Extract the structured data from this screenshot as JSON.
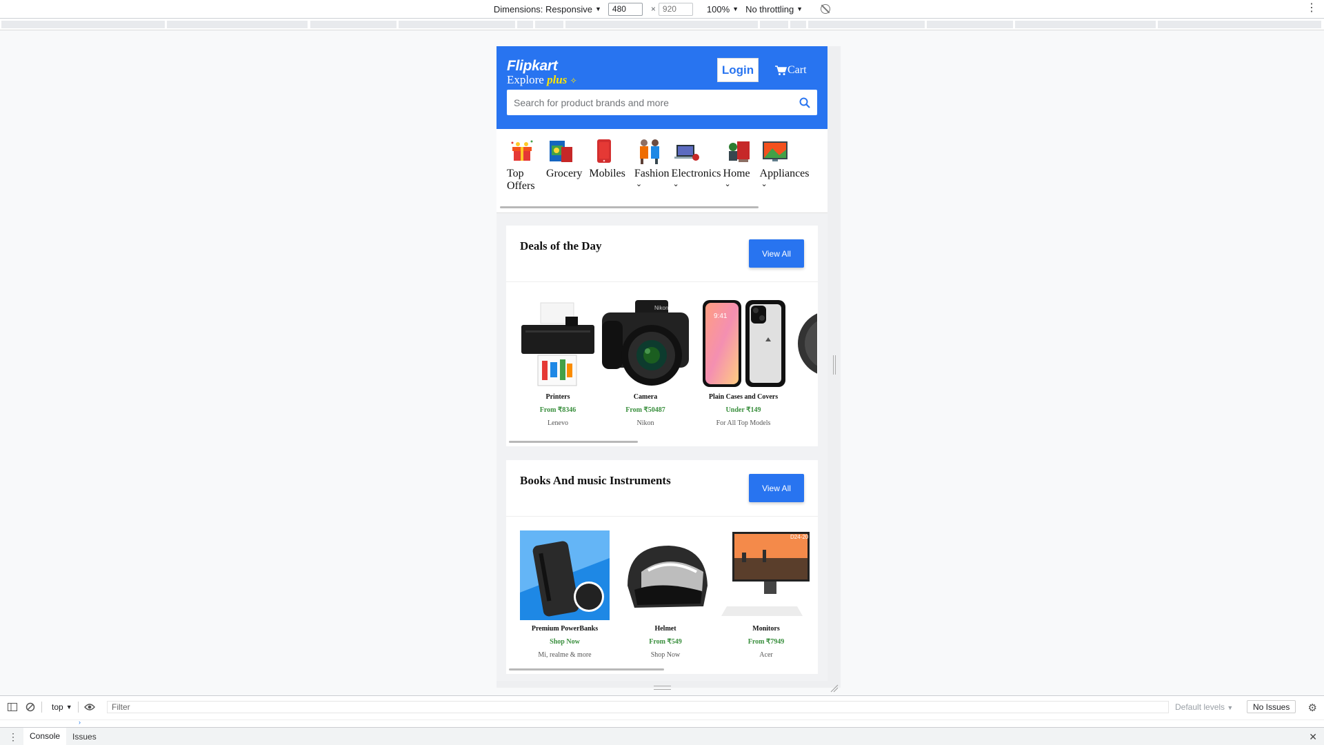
{
  "devtools": {
    "dimensions_label": "Dimensions: Responsive",
    "width": "480",
    "height": "920",
    "zoom": "100%",
    "throttling": "No throttling"
  },
  "header": {
    "logo": "Flipkart",
    "explore": "Explore",
    "plus": "plus",
    "login": "Login",
    "cart": "Cart",
    "search_placeholder": "Search for product brands and more"
  },
  "categories": [
    {
      "line1": "Top",
      "line2": "Offers",
      "chevron": false,
      "icon": "gift-icon"
    },
    {
      "line1": "Grocery",
      "line2": "",
      "chevron": false,
      "icon": "grocery-icon"
    },
    {
      "line1": "Mobiles",
      "line2": "",
      "chevron": false,
      "icon": "mobile-icon"
    },
    {
      "line1": "Fashion",
      "line2": "",
      "chevron": true,
      "icon": "fashion-icon"
    },
    {
      "line1": "Electronics",
      "line2": "",
      "chevron": true,
      "icon": "laptop-icon"
    },
    {
      "line1": "Home",
      "line2": "",
      "chevron": true,
      "icon": "home-icon"
    },
    {
      "line1": "Appliances",
      "line2": "",
      "chevron": true,
      "icon": "tv-icon"
    }
  ],
  "deals": {
    "title": "Deals of the Day",
    "view_all": "View All",
    "items": [
      {
        "name": "Printers",
        "price": "From ₹8346",
        "sub": "Lenevo",
        "icon": "printer-icon"
      },
      {
        "name": "Camera",
        "price": "From ₹50487",
        "sub": "Nikon",
        "icon": "camera-icon"
      },
      {
        "name": "Plain Cases and Covers",
        "price": "Under ₹149",
        "sub": "For All Top Models",
        "icon": "phone-case-icon"
      }
    ]
  },
  "books": {
    "title": "Books And music Instruments",
    "view_all": "View All",
    "items": [
      {
        "name": "Premium PowerBanks",
        "price": "Shop Now",
        "sub": "Mi, realme & more",
        "icon": "powerbank-icon"
      },
      {
        "name": "Helmet",
        "price": "From ₹549",
        "sub": "Shop Now",
        "icon": "helmet-icon"
      },
      {
        "name": "Monitors",
        "price": "From ₹7949",
        "sub": "Acer",
        "icon": "monitor-icon"
      }
    ]
  },
  "console": {
    "context": "top",
    "filter_placeholder": "Filter",
    "levels": "Default levels",
    "issues": "No Issues",
    "tabs": [
      "Console",
      "Issues"
    ]
  },
  "colors": {
    "brand": "#2874f0",
    "price_green": "#388e3c",
    "plus_yellow": "#ffe500"
  }
}
